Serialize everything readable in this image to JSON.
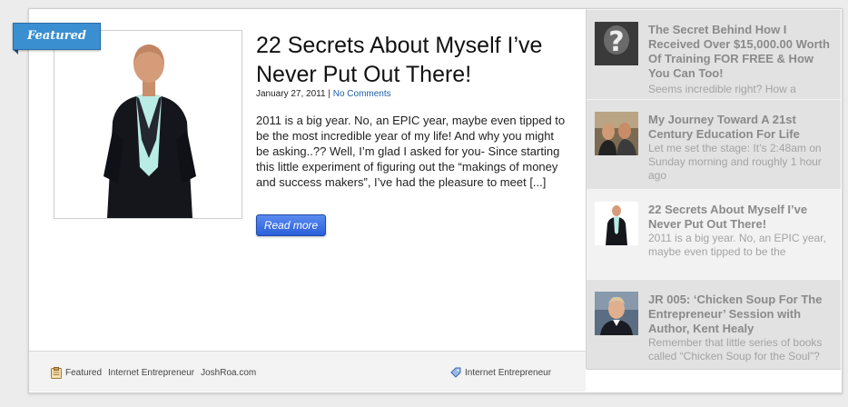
{
  "featured_badge": "Featured",
  "post": {
    "title": "22 Secrets About Myself I’ve Never Put Out There!",
    "date": "January 27, 2011",
    "separator": "|",
    "comments": "No Comments",
    "excerpt": "2011 is a big year. No, an EPIC year, maybe even tipped to be the most incredible year of my life! And why you might be asking..?? Well, I’m glad I asked for you- Since starting this  little experiment of figuring out the “makings of money and success makers”, I’ve had the pleasure to meet [...]",
    "read_more": "Read more"
  },
  "footer": {
    "tags": [
      "Featured",
      "Internet Entrepreneur",
      "JoshRoa.com"
    ],
    "category": "Internet Entrepreneur"
  },
  "sidebar": {
    "items": [
      {
        "title": "The Secret Behind How I Received Over $15,000.00 Worth Of Training FOR FREE & How You Can Too!",
        "excerpt": "Seems incredible right? How a",
        "thumb": "question-mark-thumbnail"
      },
      {
        "title": "My Journey Toward A 21st Century Education For Life",
        "excerpt": "Let me set the stage: It’s 2:48am on Sunday morning and roughly 1 hour ago",
        "thumb": "two-men-thumbnail"
      },
      {
        "title": "22 Secrets About Myself I’ve Never Put Out There!",
        "excerpt": "2011 is a big year. No, an EPIC year, maybe even tipped to be the",
        "thumb": "man-in-suit-thumbnail"
      },
      {
        "title": "JR 005: ‘Chicken Soup For The Entrepreneur’ Session with Author, Kent Healy",
        "excerpt": "Remember that little series of books called “Chicken Soup for the Soul”?",
        "thumb": "man-smiling-thumbnail"
      }
    ]
  },
  "colors": {
    "ribbon": "#3a8fd1",
    "read_more_button": "#2a5fd8",
    "link": "#1e5fa8",
    "sidebar_bg": "#e2e2e2",
    "sidebar_text": "#8a8a8a"
  }
}
